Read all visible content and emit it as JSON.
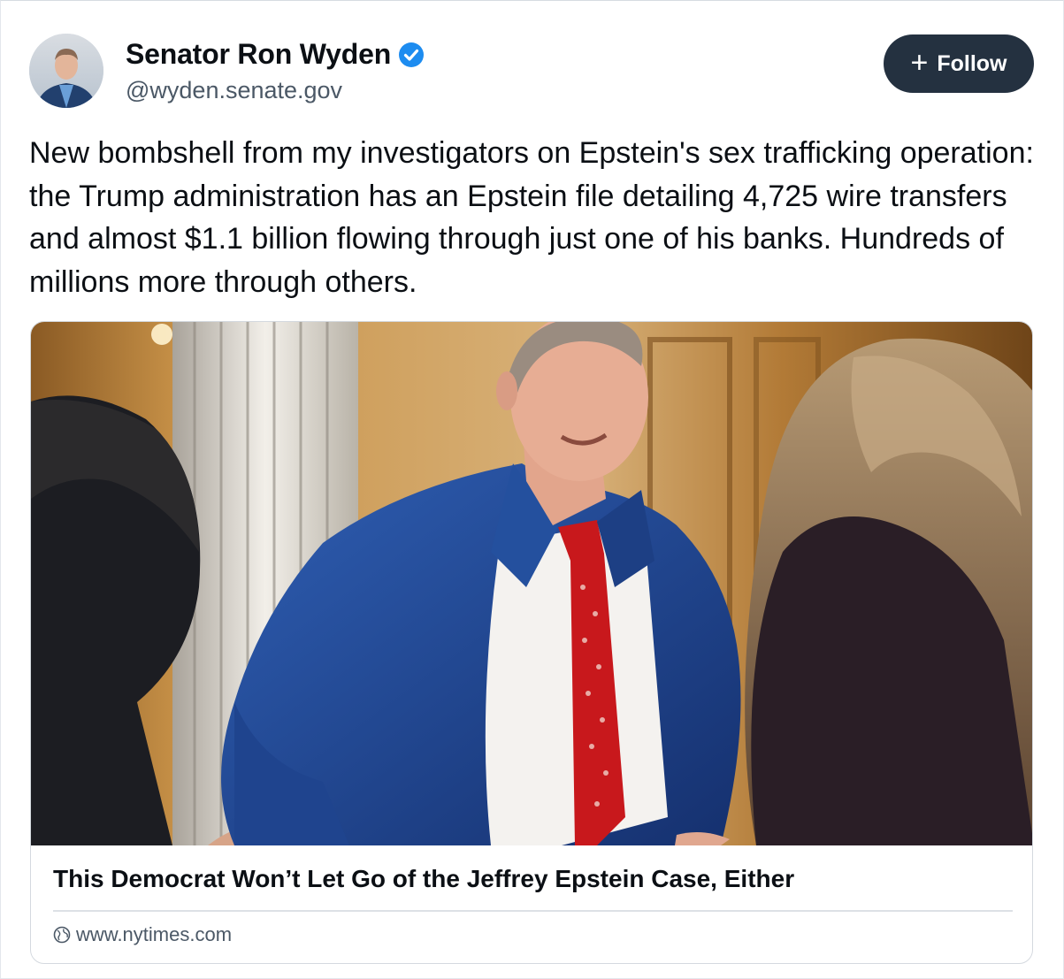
{
  "author": {
    "display_name": "Senator Ron Wyden",
    "handle": "@wyden.senate.gov",
    "verified": true
  },
  "follow_button": {
    "icon": "plus-icon",
    "label": "Follow"
  },
  "post": {
    "text": "New bombshell from my investigators on Epstein's sex trafficking operation: the Trump administration has an Epstein file detailing 4,725 wire transfers and almost $1.1 billion flowing through just one of his banks. Hundreds of millions more through others."
  },
  "link_card": {
    "image": "photo-senator-speaking-with-reporters",
    "title": "This Democrat Won’t Let Go of the Jeffrey Epstein Case, Either",
    "source_icon": "globe-icon",
    "source": "www.nytimes.com"
  },
  "colors": {
    "button_bg": "#243140",
    "verified_blue": "#1d8cf0",
    "muted_text": "#4b5866"
  }
}
